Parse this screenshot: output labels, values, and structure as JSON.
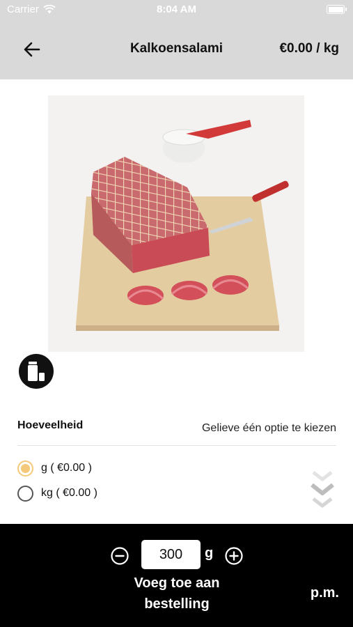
{
  "status_bar": {
    "carrier": "Carrier",
    "time": "8:04 AM"
  },
  "nav": {
    "title": "Kalkoensalami",
    "price": "€0.00 / kg"
  },
  "product": {
    "quantity_label": "Hoeveelheid",
    "quantity_hint": "Gelieve één optie te kiezen",
    "options": [
      {
        "label": "g ( €0.00 )",
        "selected": true
      },
      {
        "label": "kg ( €0.00 )",
        "selected": false
      }
    ]
  },
  "order": {
    "quantity": "300",
    "unit": "g",
    "add_button_line1": "Voeg toe aan",
    "add_button_line2": "bestelling",
    "price": "p.m."
  },
  "colors": {
    "nav_bg": "#d9d9d9",
    "radio_selected": "#f5c97a",
    "bottom_bar": "#000000"
  },
  "icons": [
    "back-arrow-icon",
    "wifi-icon",
    "battery-icon",
    "container-icon",
    "chevron-down-icon",
    "minus-circle-icon",
    "plus-circle-icon"
  ]
}
